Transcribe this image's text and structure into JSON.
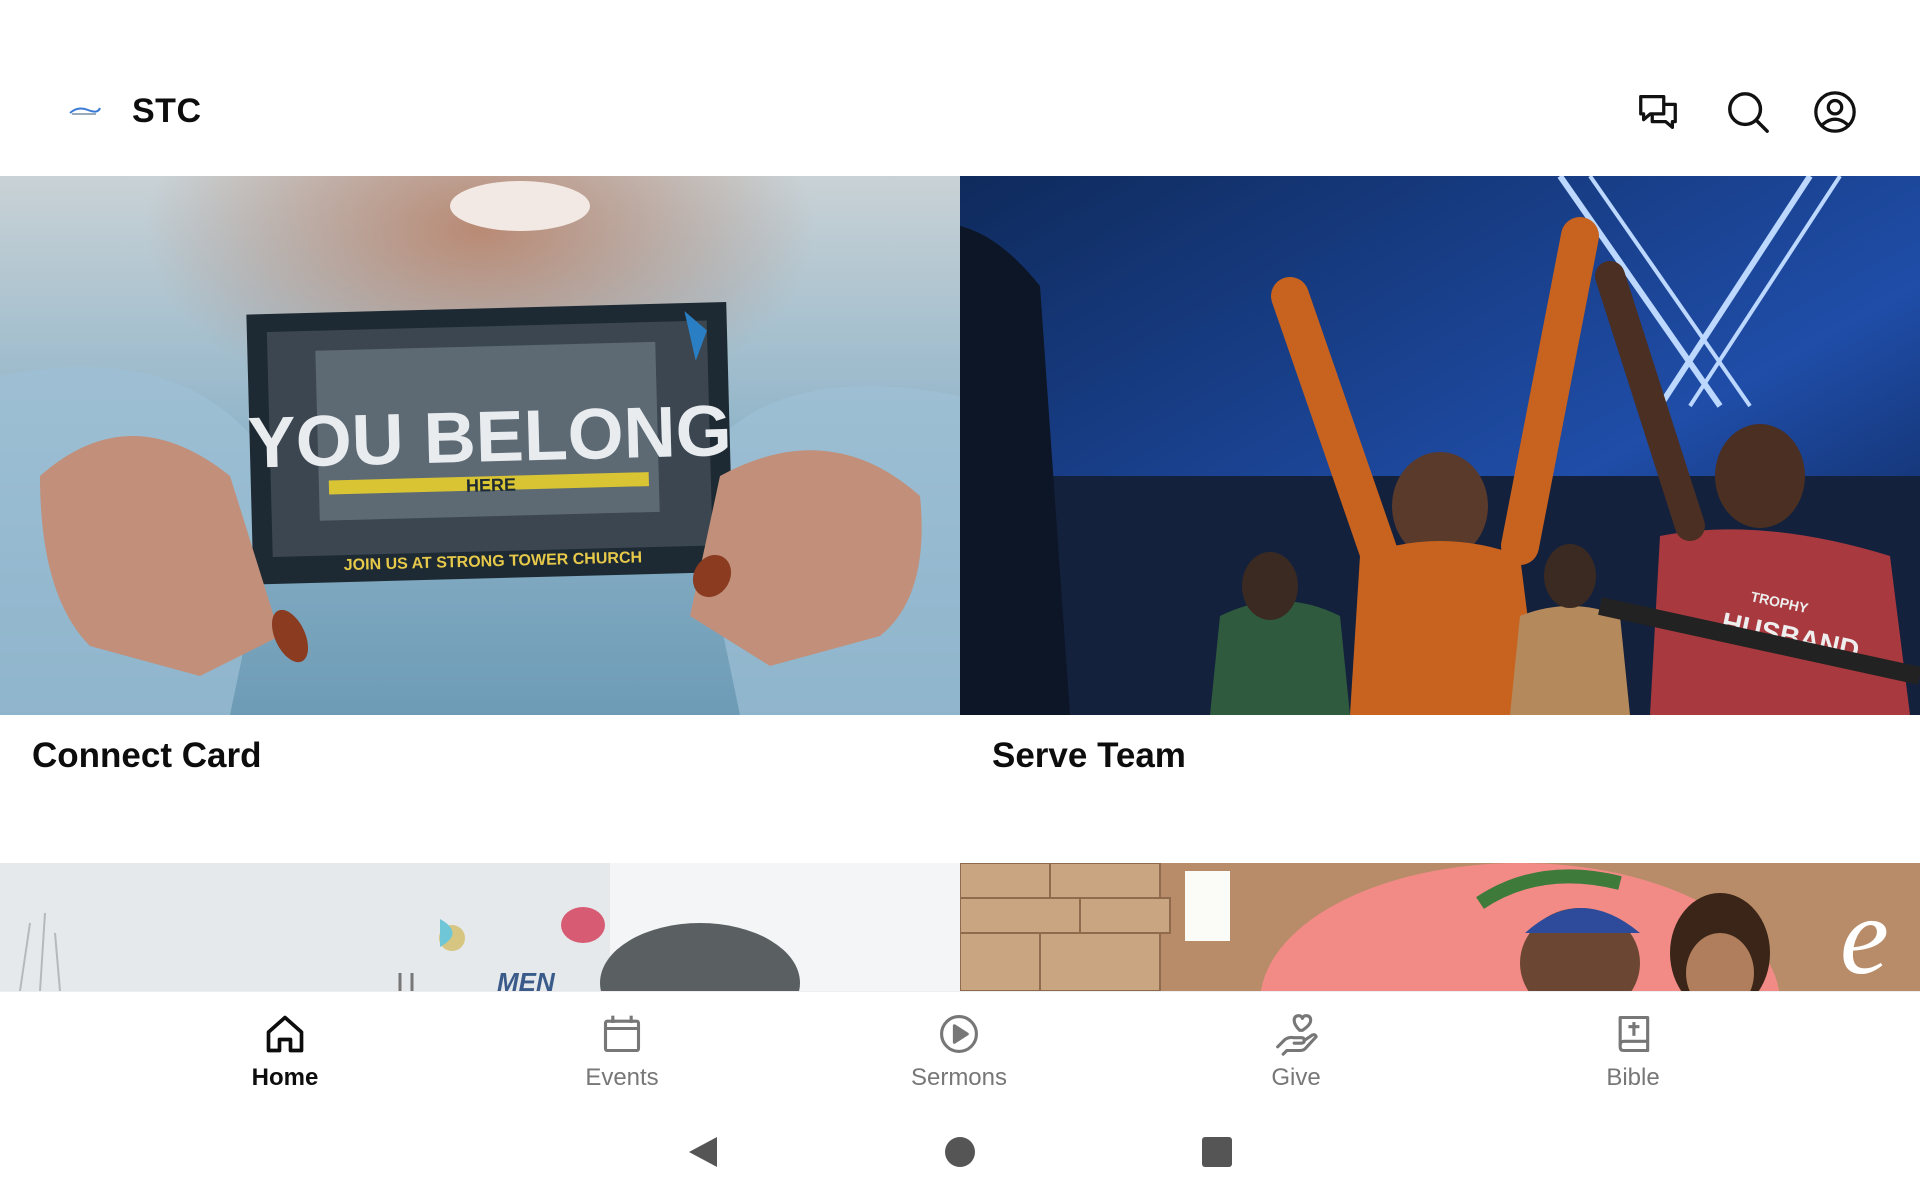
{
  "header": {
    "title": "STC",
    "logo_icon": "stc-logo-icon",
    "icons": [
      "messages-icon",
      "search-icon",
      "account-icon"
    ]
  },
  "cards": [
    {
      "title": "Connect Card",
      "image": "card held in hands reading YOU BELONG HERE",
      "image_text_main": "YOU BELONG",
      "image_text_sub": "HERE",
      "image_text_footer": "JOIN US AT STRONG TOWER CHURCH"
    },
    {
      "title": "Serve Team",
      "image": "congregation celebrating with raised hands",
      "shirt_text": "HUSBAND",
      "shirt_text_small": "TROPHY"
    },
    {
      "title": "",
      "image": "outdoor event graphic",
      "image_text": "MEN"
    },
    {
      "title": "",
      "image": "family photo in front of stone wall"
    }
  ],
  "bottom_nav": {
    "items": [
      {
        "label": "Home",
        "icon": "home-icon",
        "active": true
      },
      {
        "label": "Events",
        "icon": "calendar-icon",
        "active": false
      },
      {
        "label": "Sermons",
        "icon": "play-circle-icon",
        "active": false
      },
      {
        "label": "Give",
        "icon": "give-hand-heart-icon",
        "active": false
      },
      {
        "label": "Bible",
        "icon": "bible-icon",
        "active": false
      }
    ]
  },
  "system_nav": [
    "back-icon",
    "home-circle-icon",
    "recents-square-icon"
  ],
  "colors": {
    "active": "#0d0d0d",
    "inactive": "#777777",
    "background": "#ffffff"
  }
}
